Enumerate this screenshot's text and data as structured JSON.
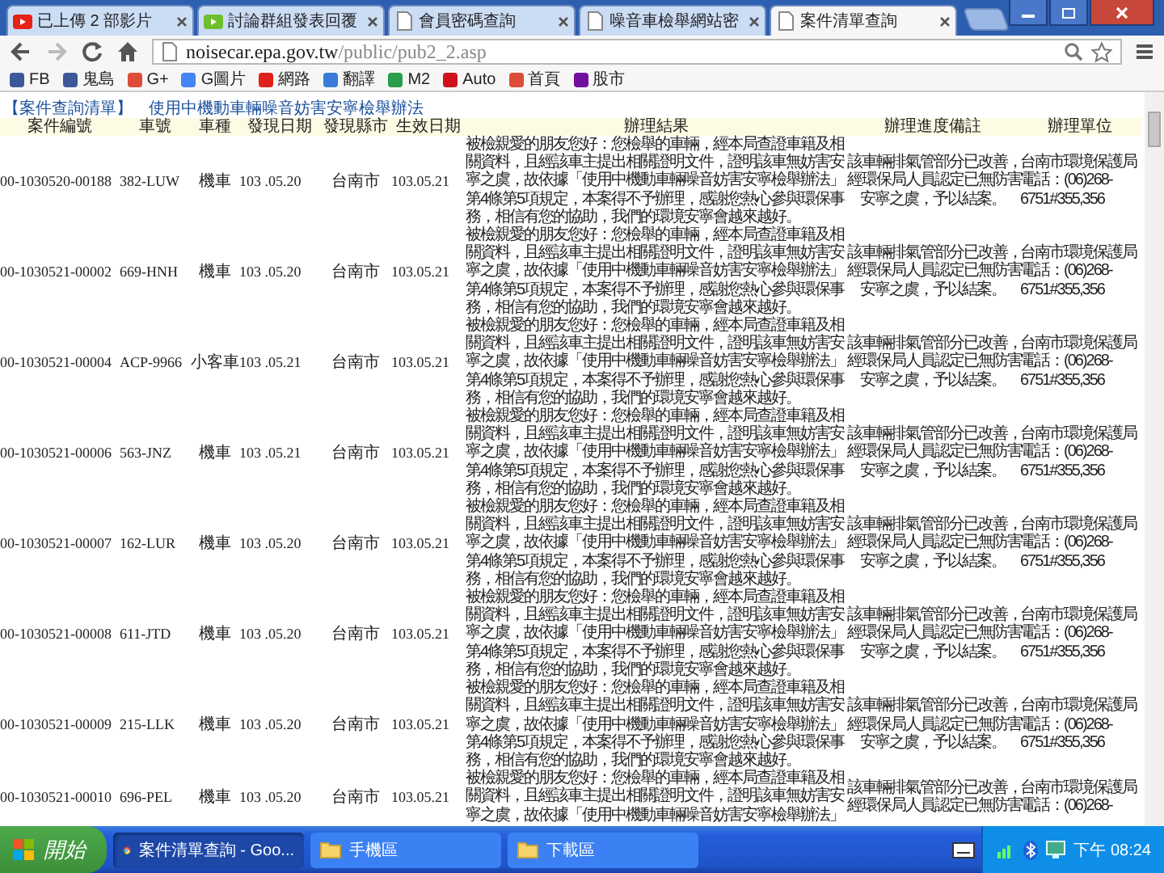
{
  "browser": {
    "tabs": [
      {
        "title": "已上傳 2 部影片",
        "selected": false
      },
      {
        "title": "討論群組發表回覆",
        "selected": false
      },
      {
        "title": "會員密碼查詢",
        "selected": false
      },
      {
        "title": "噪音車檢舉網站密",
        "selected": false
      },
      {
        "title": "案件清單查詢",
        "selected": true
      }
    ],
    "address": {
      "host": "noisecar.epa.gov.tw",
      "path": "/public/pub2_2.asp"
    },
    "bookmarks": [
      "FB",
      "鬼島",
      "G+",
      "G圖片",
      "網路",
      "翻譯",
      "M2",
      "Auto",
      "首頁",
      "股市"
    ]
  },
  "page": {
    "heading": "【案件查詢清單】",
    "law": "使用中機動車輛噪音妨害安寧檢舉辦法",
    "columns": [
      "案件編號",
      "車號",
      "車種",
      "發現日期",
      "發現縣市",
      "生效日期",
      "辦理結果",
      "辦理進度備註",
      "辦理單位"
    ],
    "rows": [
      {
        "case_no": "00-1030520-00188",
        "plate": "382-LUW",
        "vehicle": "機車",
        "found": "103 .05.20",
        "city": "台南市",
        "effective": "103.05.21",
        "result": [
          "被檢親愛的朋友您好：您檢舉的車輛，經本局查證車籍及相",
          "關資料，且經該車主提出相關證明文件，證明該車無妨害安",
          "寧之虞，故依據「使用中機動車輛噪音妨害安寧檢舉辦法」",
          "第4條第5項規定，本案得不予辦理，感謝您熱心參與環保事",
          "務，相信有您的協助，我們的環境安寧會越來越好。"
        ],
        "notes": [
          "該車輛排氣管部分已改善，",
          "經環保局人員認定已無防害",
          "安寧之虞，予以結案。"
        ],
        "unit": [
          "台南市環境保護局",
          "電話：(06)268-",
          "6751#355,356"
        ]
      },
      {
        "case_no": "00-1030521-00002",
        "plate": "669-HNH",
        "vehicle": "機車",
        "found": "103 .05.20",
        "city": "台南市",
        "effective": "103.05.21",
        "result": [
          "被檢親愛的朋友您好：您檢舉的車輛，經本局查證車籍及相",
          "關資料，且經該車主提出相關證明文件，證明該車無妨害安",
          "寧之虞，故依據「使用中機動車輛噪音妨害安寧檢舉辦法」",
          "第4條第5項規定，本案得不予辦理，感謝您熱心參與環保事",
          "務，相信有您的協助，我們的環境安寧會越來越好。"
        ],
        "notes": [
          "該車輛排氣管部分已改善，",
          "經環保局人員認定已無防害",
          "安寧之虞，予以結案。"
        ],
        "unit": [
          "台南市環境保護局",
          "電話：(06)268-",
          "6751#355,356"
        ]
      },
      {
        "case_no": "00-1030521-00004",
        "plate": "ACP-9966",
        "vehicle": "小客車",
        "found": "103 .05.21",
        "city": "台南市",
        "effective": "103.05.21",
        "result": [
          "被檢親愛的朋友您好：您檢舉的車輛，經本局查證車籍及相",
          "關資料，且經該車主提出相關證明文件，證明該車無妨害安",
          "寧之虞，故依據「使用中機動車輛噪音妨害安寧檢舉辦法」",
          "第4條第5項規定，本案得不予辦理，感謝您熱心參與環保事",
          "務，相信有您的協助，我們的環境安寧會越來越好。"
        ],
        "notes": [
          "該車輛排氣管部分已改善，",
          "經環保局人員認定已無防害",
          "安寧之虞，予以結案。"
        ],
        "unit": [
          "台南市環境保護局",
          "電話：(06)268-",
          "6751#355,356"
        ]
      },
      {
        "case_no": "00-1030521-00006",
        "plate": "563-JNZ",
        "vehicle": "機車",
        "found": "103 .05.21",
        "city": "台南市",
        "effective": "103.05.21",
        "result": [
          "被檢親愛的朋友您好：您檢舉的車輛，經本局查證車籍及相",
          "關資料，且經該車主提出相關證明文件，證明該車無妨害安",
          "寧之虞，故依據「使用中機動車輛噪音妨害安寧檢舉辦法」",
          "第4條第5項規定，本案得不予辦理，感謝您熱心參與環保事",
          "務，相信有您的協助，我們的環境安寧會越來越好。"
        ],
        "notes": [
          "該車輛排氣管部分已改善，",
          "經環保局人員認定已無防害",
          "安寧之虞，予以結案。"
        ],
        "unit": [
          "台南市環境保護局",
          "電話：(06)268-",
          "6751#355,356"
        ]
      },
      {
        "case_no": "00-1030521-00007",
        "plate": "162-LUR",
        "vehicle": "機車",
        "found": "103 .05.20",
        "city": "台南市",
        "effective": "103.05.21",
        "result": [
          "被檢親愛的朋友您好：您檢舉的車輛，經本局查證車籍及相",
          "關資料，且經該車主提出相關證明文件，證明該車無妨害安",
          "寧之虞，故依據「使用中機動車輛噪音妨害安寧檢舉辦法」",
          "第4條第5項規定，本案得不予辦理，感謝您熱心參與環保事",
          "務，相信有您的協助，我們的環境安寧會越來越好。"
        ],
        "notes": [
          "該車輛排氣管部分已改善，",
          "經環保局人員認定已無防害",
          "安寧之虞，予以結案。"
        ],
        "unit": [
          "台南市環境保護局",
          "電話：(06)268-",
          "6751#355,356"
        ]
      },
      {
        "case_no": "00-1030521-00008",
        "plate": "611-JTD",
        "vehicle": "機車",
        "found": "103 .05.20",
        "city": "台南市",
        "effective": "103.05.21",
        "result": [
          "被檢親愛的朋友您好：您檢舉的車輛，經本局查證車籍及相",
          "關資料，且經該車主提出相關證明文件，證明該車無妨害安",
          "寧之虞，故依據「使用中機動車輛噪音妨害安寧檢舉辦法」",
          "第4條第5項規定，本案得不予辦理，感謝您熱心參與環保事",
          "務，相信有您的協助，我們的環境安寧會越來越好。"
        ],
        "notes": [
          "該車輛排氣管部分已改善，",
          "經環保局人員認定已無防害",
          "安寧之虞，予以結案。"
        ],
        "unit": [
          "台南市環境保護局",
          "電話：(06)268-",
          "6751#355,356"
        ]
      },
      {
        "case_no": "00-1030521-00009",
        "plate": "215-LLK",
        "vehicle": "機車",
        "found": "103 .05.20",
        "city": "台南市",
        "effective": "103.05.21",
        "result": [
          "被檢親愛的朋友您好：您檢舉的車輛，經本局查證車籍及相",
          "關資料，且經該車主提出相關證明文件，證明該車無妨害安",
          "寧之虞，故依據「使用中機動車輛噪音妨害安寧檢舉辦法」",
          "第4條第5項規定，本案得不予辦理，感謝您熱心參與環保事",
          "務，相信有您的協助，我們的環境安寧會越來越好。"
        ],
        "notes": [
          "該車輛排氣管部分已改善，",
          "經環保局人員認定已無防害",
          "安寧之虞，予以結案。"
        ],
        "unit": [
          "台南市環境保護局",
          "電話：(06)268-",
          "6751#355,356"
        ]
      },
      {
        "case_no": "00-1030521-00010",
        "plate": "696-PEL",
        "vehicle": "機車",
        "found": "103 .05.20",
        "city": "台南市",
        "effective": "103.05.21",
        "result": [
          "被檢親愛的朋友您好：您檢舉的車輛，經本局查證車籍及相",
          "關資料，且經該車主提出相關證明文件，證明該車無妨害安",
          "寧之虞，故依據「使用中機動車輛噪音妨害安寧檢舉辦法」"
        ],
        "notes": [
          "該車輛排氣管部分已改善，",
          "經環保局人員認定已無防害"
        ],
        "unit": [
          "台南市環境保護局",
          "電話：(06)268-"
        ]
      }
    ]
  },
  "taskbar": {
    "start": "開始",
    "windows": [
      {
        "title": "案件清單查詢 - Goo...",
        "selected": true
      },
      {
        "title": "手機區",
        "selected": false
      },
      {
        "title": "下載區",
        "selected": false
      }
    ],
    "clock": "下午 08:24"
  }
}
